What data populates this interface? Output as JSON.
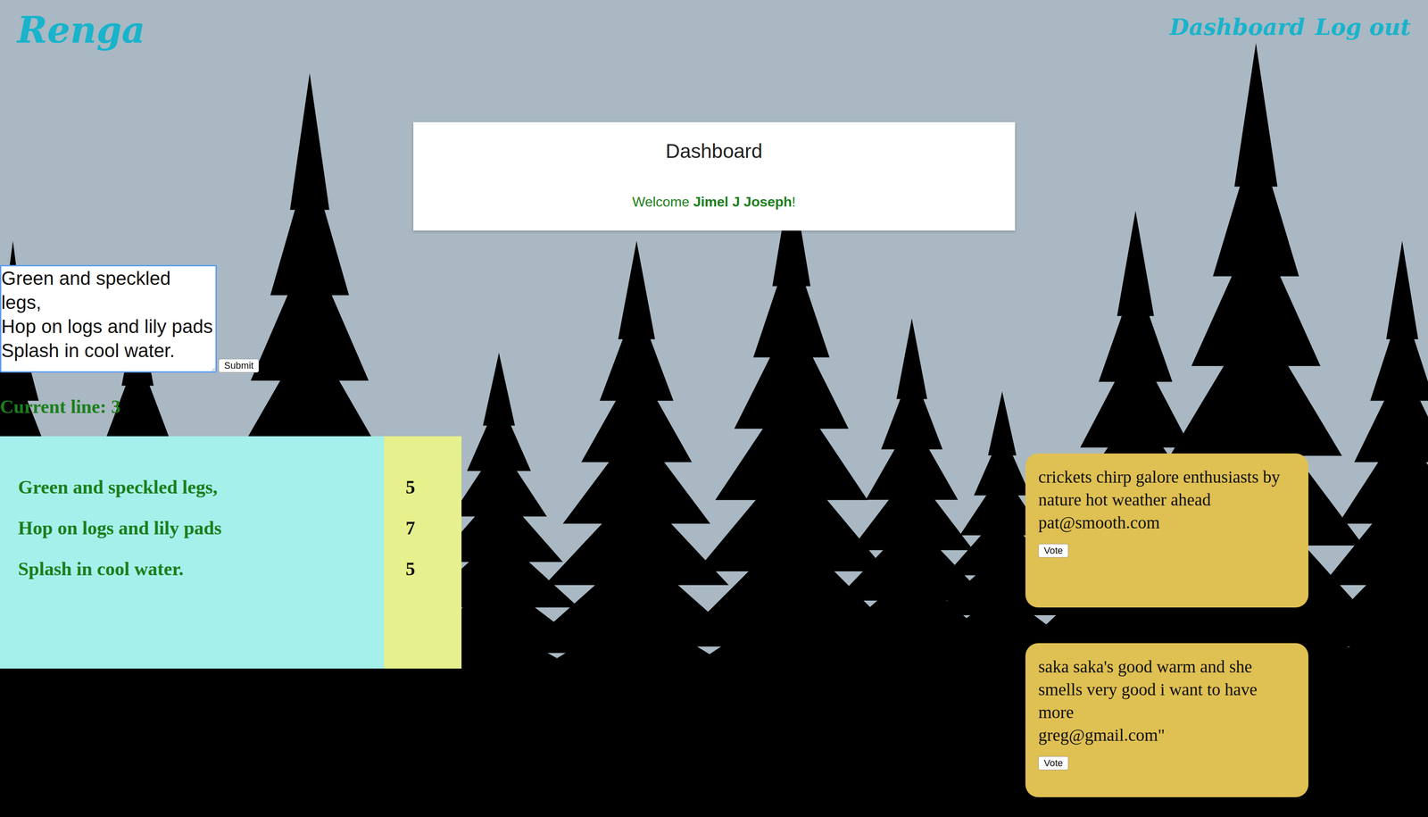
{
  "header": {
    "logo": "Renga",
    "nav": [
      {
        "label": "Dashboard"
      },
      {
        "label": "Log out"
      }
    ]
  },
  "dashboard": {
    "title": "Dashboard",
    "greeting": "Welcome",
    "user": "Jimel J Joseph",
    "suffix": "!"
  },
  "composer": {
    "value": "Green and speckled legs,\nHop on logs and lily pads\nSplash in cool water.",
    "button": "Submit"
  },
  "current_line": "Current line: 3",
  "poem": [
    {
      "line": "Green and speckled legs,",
      "syllables": "5"
    },
    {
      "line": "Hop on logs and lily pads",
      "syllables": "7"
    },
    {
      "line": "Splash in cool water.",
      "syllables": "5"
    }
  ],
  "submissions": [
    {
      "text": "crickets chirp galore enthusiasts by nature hot weather ahead",
      "author": "pat@smooth.com",
      "button": "Vote"
    },
    {
      "text": "saka saka's good warm and she smells very good i want to have more",
      "author": "greg@gmail.com\"",
      "button": "Vote"
    }
  ]
}
